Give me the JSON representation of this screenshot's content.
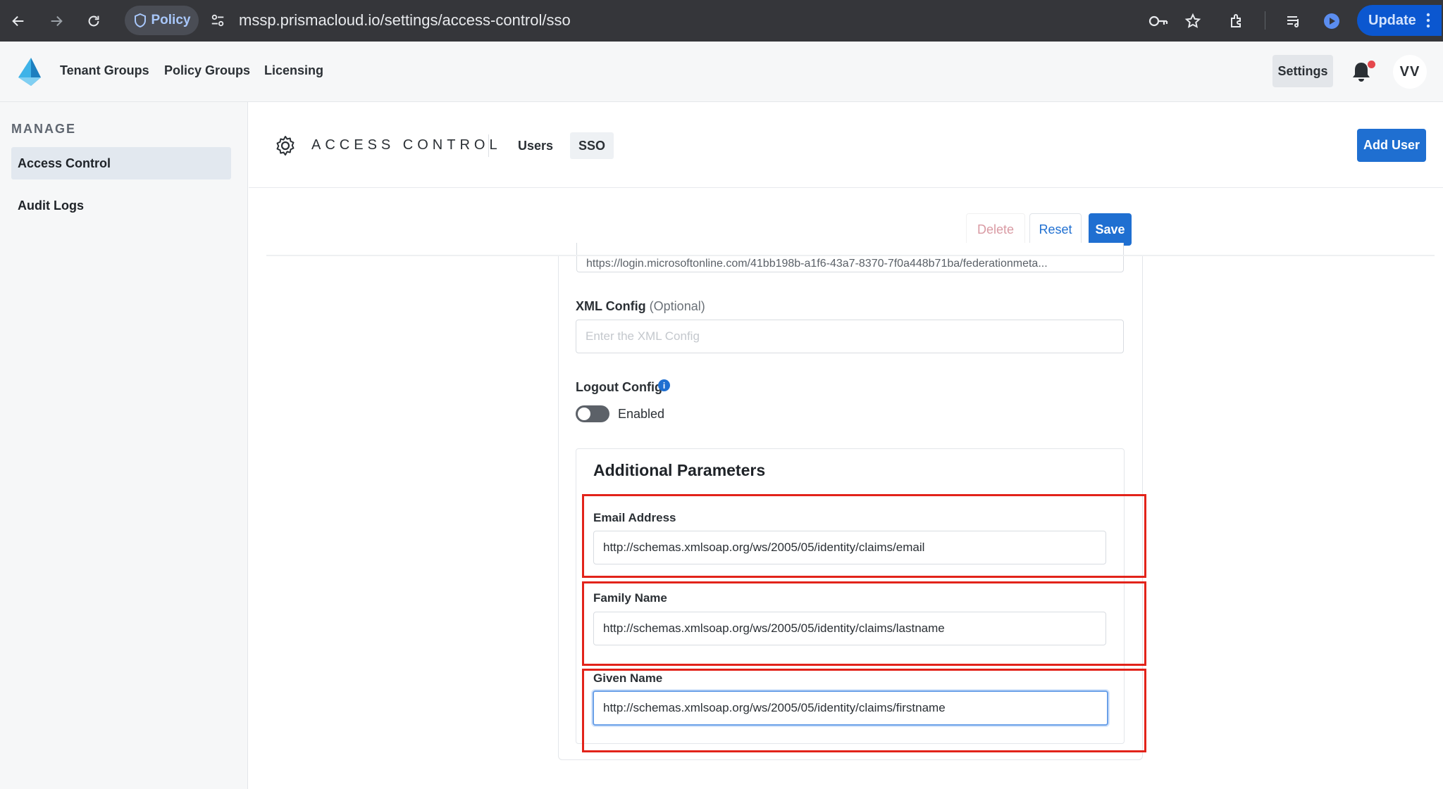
{
  "browser": {
    "policy_chip": "Policy",
    "url": "mssp.prismacloud.io/settings/access-control/sso",
    "update_label": "Update"
  },
  "header": {
    "nav": [
      "Tenant Groups",
      "Policy Groups",
      "Licensing"
    ],
    "settings_label": "Settings",
    "avatar_initials": "VV"
  },
  "sidebar": {
    "section_label": "MANAGE",
    "items": [
      {
        "label": "Access Control",
        "active": true
      },
      {
        "label": "Audit Logs",
        "active": false
      }
    ]
  },
  "page": {
    "title": "ACCESS CONTROL",
    "tabs": [
      {
        "label": "Users",
        "active": false
      },
      {
        "label": "SSO",
        "active": true
      }
    ],
    "add_user_label": "Add User"
  },
  "actions": {
    "delete_label": "Delete",
    "reset_label": "Reset",
    "save_label": "Save"
  },
  "form": {
    "metadata_url_value": "https://login.microsoftonline.com/41bb198b-a1f6-43a7-8370-7f0a448b71ba/federationmeta...",
    "xml_config": {
      "label": "XML Config",
      "optional_hint": "(Optional)",
      "placeholder": "Enter the XML Config"
    },
    "logout_config": {
      "label": "Logout Config",
      "toggle_label": "Enabled",
      "enabled": false
    },
    "additional_parameters": {
      "title": "Additional Parameters",
      "email": {
        "label": "Email Address",
        "value": "http://schemas.xmlsoap.org/ws/2005/05/identity/claims/email"
      },
      "family_name": {
        "label": "Family Name",
        "value": "http://schemas.xmlsoap.org/ws/2005/05/identity/claims/lastname"
      },
      "given_name": {
        "label": "Given Name",
        "value": "http://schemas.xmlsoap.org/ws/2005/05/identity/claims/firstname"
      }
    }
  },
  "colors": {
    "accent": "#1f6fd1",
    "highlight": "#e2231a",
    "browser_bar": "#35363a"
  }
}
